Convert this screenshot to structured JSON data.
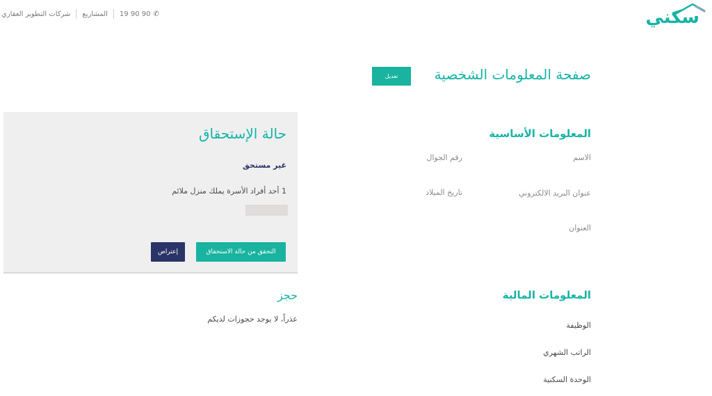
{
  "header": {
    "logo_text": "سكني",
    "phone_number": "19 90 90",
    "nav": [
      "المشاريع",
      "شركات التطوير العقاري"
    ]
  },
  "page": {
    "title": "صفحة المعلومات الشخصية",
    "edit_label": "تعديل"
  },
  "basic_info": {
    "title": "المعلومات الأساسية",
    "name_label": "الاسم",
    "mobile_label": "رقم الجوال",
    "email_label": "عنوان البريد الالكتروني",
    "dob_label": "تاريخ الميلاد",
    "address_label": "العنوان"
  },
  "financial_info": {
    "title": "المعلومات المالية",
    "job_label": "الوظيفة",
    "salary_label": "الراتب الشهري",
    "unit_label": "الوحدة السكنية"
  },
  "eligibility": {
    "title": "حالة الإستحقاق",
    "status": "غير مستحق",
    "reason": "1 أحد أفراد الأسرة يملك منزل ملائم",
    "verify_label": "التحقق من حالة الاستحقاق",
    "objection_label": "إعتراض"
  },
  "booking": {
    "title": "حجز",
    "empty_text": "عذراً، لا يوجد حجوزات لديكم"
  },
  "colors": {
    "accent": "#16b4a6",
    "button_teal": "#19b39f",
    "button_navy": "#2b3467",
    "card_bg": "#efefef"
  }
}
